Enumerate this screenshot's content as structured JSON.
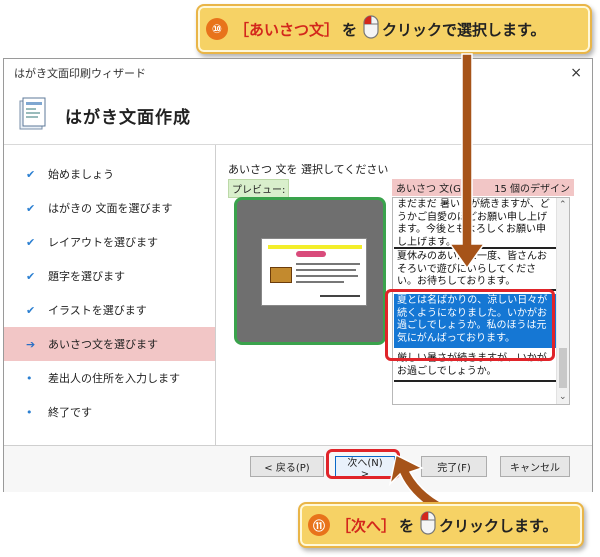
{
  "callout_top": {
    "number": "⑩",
    "before": "［あいさつ文］",
    "mid": "を",
    "after": "クリックで選択します。"
  },
  "callout_bottom": {
    "number": "⑪",
    "before": "［次へ］",
    "mid": "を",
    "after": "クリックします。"
  },
  "window": {
    "title": "はがき文面印刷ウィザード",
    "close": "×",
    "header_title": "はがき文面作成"
  },
  "sidebar": {
    "items": [
      {
        "label": "始めましょう",
        "mark": "✔"
      },
      {
        "label": "はがきの 文面を選びます",
        "mark": "✔"
      },
      {
        "label": "レイアウトを選びます",
        "mark": "✔"
      },
      {
        "label": "題字を選びます",
        "mark": "✔"
      },
      {
        "label": "イラストを選びます",
        "mark": "✔"
      },
      {
        "label": "あいさつ文を選びます",
        "mark": "➔"
      },
      {
        "label": "差出人の住所を入力します",
        "mark": "•"
      },
      {
        "label": "終了です",
        "mark": "•"
      }
    ]
  },
  "content": {
    "instruction": "あいさつ 文を 選択してください",
    "preview_label": "プレビュー:",
    "greeting_label": "あいさつ 文(G):",
    "design_count": "15 個のデザイン",
    "greetings": [
      "まだまだ 暑い日が続きますが、どうかご自愛のほどお願い申し上げます。今後ともよろしくお願い申し上げます。",
      "夏休みのあいだに一度、皆さんおそろいで遊びにいらしてください。お待ちしております。",
      "夏とは名ばかりの、涼しい日々が続くようになりました。いかがお過ごしでしょうか。私のほうは元気にがんばっております。",
      "厳しい暑さが続きますが、いかがお過ごしでしょうか。"
    ],
    "scroll_up": "⌃",
    "scroll_down": "⌄"
  },
  "footer": {
    "back": "< 戻る(P)",
    "next": "次へ(N) >",
    "finish": "完了(F)",
    "cancel": "キャンセル"
  }
}
